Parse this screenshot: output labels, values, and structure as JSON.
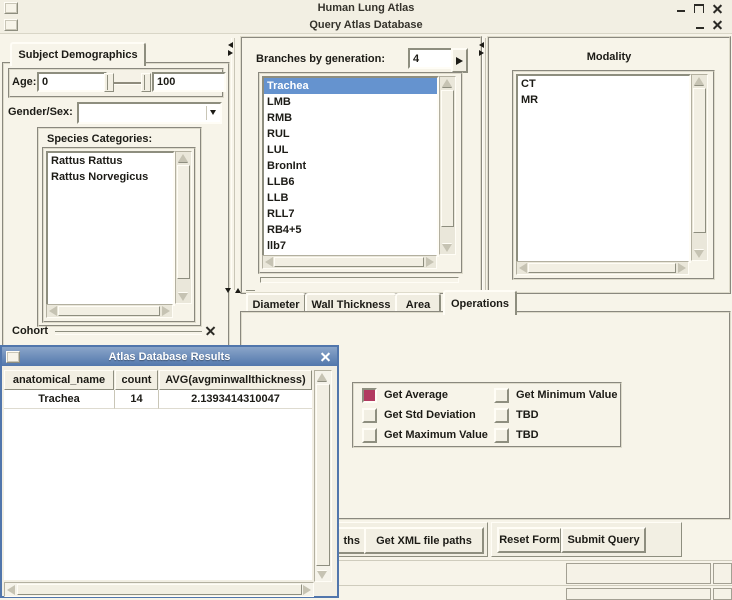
{
  "window": {
    "title": "Human Lung Atlas"
  },
  "query_window": {
    "title": "Query Atlas Database"
  },
  "demographics": {
    "tab_label": "Subject Demographics",
    "age_label": "Age:",
    "age_min": "0",
    "age_max": "100",
    "gender_label": "Gender/Sex:",
    "gender_value": "",
    "species_label": "Species Categories:",
    "species_items": [
      "Rattus Rattus",
      "Rattus Norvegicus"
    ],
    "cohort_label": "Cohort"
  },
  "branches": {
    "label": "Branches by generation:",
    "value": "4",
    "selected_index": 0,
    "items": [
      "Trachea",
      "LMB",
      "RMB",
      "RUL",
      "LUL",
      "BronInt",
      "LLB6",
      "LLB",
      "RLL7",
      "RB4+5",
      "llb7"
    ]
  },
  "modality": {
    "label": "Modality",
    "items": [
      "CT",
      "MR"
    ]
  },
  "tabs": [
    {
      "label": "Diameter"
    },
    {
      "label": "Wall Thickness"
    },
    {
      "label": "Area"
    },
    {
      "label": "Operations",
      "active": true
    }
  ],
  "operations": {
    "checkboxes": [
      {
        "label": "Get Average",
        "checked": true
      },
      {
        "label": "Get Std Deviation",
        "checked": false
      },
      {
        "label": "Get Maximum Value",
        "checked": false
      },
      {
        "label": "Get Minimum Value",
        "checked": false
      },
      {
        "label": "TBD",
        "checked": false
      },
      {
        "label": "TBD",
        "checked": false
      }
    ]
  },
  "buttons": {
    "image_paths_visible": "ths",
    "xml_paths": "Get XML file paths",
    "reset": "Reset Form",
    "submit": "Submit Query"
  },
  "results_dialog": {
    "title": "Atlas Database Results",
    "columns": [
      "anatomical_name",
      "count",
      "AVG(avgminwallthickness)"
    ],
    "rows": [
      [
        "Trachea",
        "14",
        "2.1393414310047"
      ]
    ]
  },
  "colors": {
    "background": "#f7f4e9",
    "selection_blue": "#6593cf",
    "dialog_titlebar_top": "#8aa5c9",
    "dialog_titlebar_bottom": "#5277ac",
    "dialog_border": "#5176ac",
    "checkbox_checked": "#b23a60"
  }
}
